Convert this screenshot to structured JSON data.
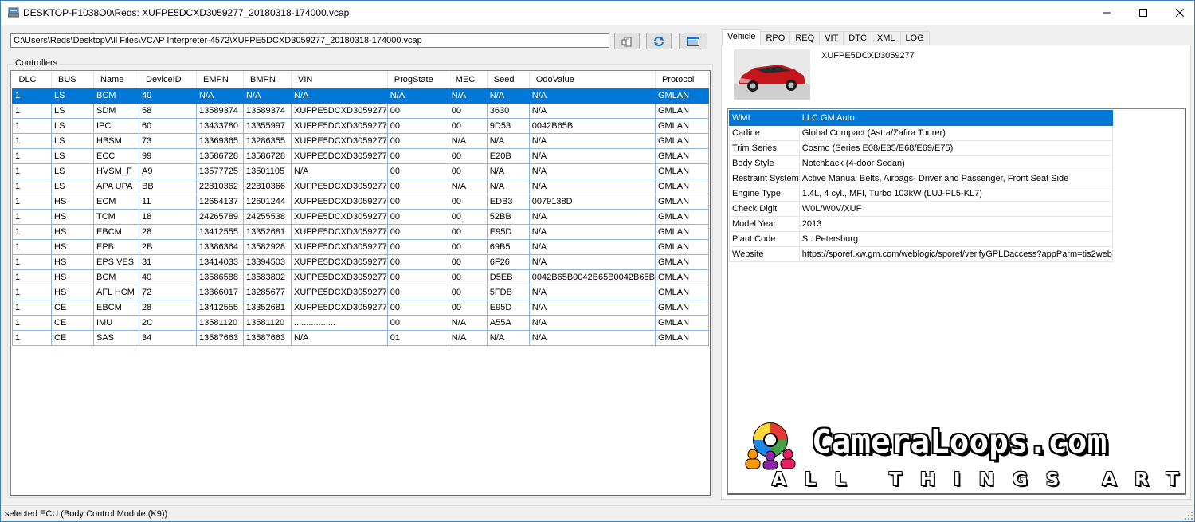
{
  "window": {
    "title": "DESKTOP-F1038O0\\Reds: XUFPE5DCXD3059277_20180318-174000.vcap"
  },
  "toolbar": {
    "path_value": "C:\\Users\\Reds\\Desktop\\All Files\\VCAP Interpreter-4572\\XUFPE5DCXD3059277_20180318-174000.vcap",
    "buttons": [
      "open-file-icon",
      "refresh-icon",
      "window-icon"
    ]
  },
  "controllers": {
    "group_label": "Controllers",
    "columns": [
      "DLC",
      "BUS",
      "Name",
      "DeviceID",
      "EMPN",
      "BMPN",
      "VIN",
      "ProgState",
      "MEC",
      "Seed",
      "OdoValue",
      "Protocol"
    ],
    "rows": [
      [
        "1",
        "LS",
        "BCM",
        "40",
        "N/A",
        "N/A",
        "N/A",
        "N/A",
        "N/A",
        "N/A",
        "N/A",
        "GMLAN"
      ],
      [
        "1",
        "LS",
        "SDM",
        "58",
        "13589374",
        "13589374",
        "XUFPE5DCXD3059277",
        "00",
        "00",
        "3630",
        "N/A",
        "GMLAN"
      ],
      [
        "1",
        "LS",
        "IPC",
        "60",
        "13433780",
        "13355997",
        "XUFPE5DCXD3059277",
        "00",
        "00",
        "9D53",
        "0042B65B",
        "GMLAN"
      ],
      [
        "1",
        "LS",
        "HBSM",
        "73",
        "13369365",
        "13286355",
        "XUFPE5DCXD3059277",
        "00",
        "N/A",
        "N/A",
        "N/A",
        "GMLAN"
      ],
      [
        "1",
        "LS",
        "ECC",
        "99",
        "13586728",
        "13586728",
        "XUFPE5DCXD3059277",
        "00",
        "00",
        "E20B",
        "N/A",
        "GMLAN"
      ],
      [
        "1",
        "LS",
        "HVSM_F",
        "A9",
        "13577725",
        "13501105",
        "N/A",
        "00",
        "00",
        "N/A",
        "N/A",
        "GMLAN"
      ],
      [
        "1",
        "LS",
        "APA UPA",
        "BB",
        "22810362",
        "22810366",
        "XUFPE5DCXD3059277",
        "00",
        "N/A",
        "N/A",
        "N/A",
        "GMLAN"
      ],
      [
        "1",
        "HS",
        "ECM",
        "11",
        "12654137",
        "12601244",
        "XUFPE5DCXD3059277",
        "00",
        "00",
        "EDB3",
        "0079138D",
        "GMLAN"
      ],
      [
        "1",
        "HS",
        "TCM",
        "18",
        "24265789",
        "24255538",
        "XUFPE5DCXD3059277",
        "00",
        "00",
        "52BB",
        "N/A",
        "GMLAN"
      ],
      [
        "1",
        "HS",
        "EBCM",
        "28",
        "13412555",
        "13352681",
        "XUFPE5DCXD3059277",
        "00",
        "00",
        "E95D",
        "N/A",
        "GMLAN"
      ],
      [
        "1",
        "HS",
        "EPB",
        "2B",
        "13386364",
        "13582928",
        "XUFPE5DCXD3059277",
        "00",
        "00",
        "69B5",
        "N/A",
        "GMLAN"
      ],
      [
        "1",
        "HS",
        "EPS VES",
        "31",
        "13414033",
        "13394503",
        "XUFPE5DCXD3059277",
        "00",
        "00",
        "6F26",
        "N/A",
        "GMLAN"
      ],
      [
        "1",
        "HS",
        "BCM",
        "40",
        "13586588",
        "13583802",
        "XUFPE5DCXD3059277",
        "00",
        "00",
        "D5EB",
        "0042B65B0042B65B0042B65B",
        "GMLAN"
      ],
      [
        "1",
        "HS",
        "AFL HCM",
        "72",
        "13366017",
        "13285677",
        "XUFPE5DCXD3059277",
        "00",
        "00",
        "5FDB",
        "N/A",
        "GMLAN"
      ],
      [
        "1",
        "CE",
        "EBCM",
        "28",
        "13412555",
        "13352681",
        "XUFPE5DCXD3059277",
        "00",
        "00",
        "E95D",
        "N/A",
        "GMLAN"
      ],
      [
        "1",
        "CE",
        "IMU",
        "2C",
        "13581120",
        "13581120",
        ".................",
        "00",
        "N/A",
        "A55A",
        "N/A",
        "GMLAN"
      ],
      [
        "1",
        "CE",
        "SAS",
        "34",
        "13587663",
        "13587663",
        "N/A",
        "01",
        "N/A",
        "N/A",
        "N/A",
        "GMLAN"
      ]
    ],
    "selected_row": 0
  },
  "right_panel": {
    "tabs": [
      "Vehicle",
      "RPO",
      "REQ",
      "VIT",
      "DTC",
      "XML",
      "LOG"
    ],
    "active_tab": 0,
    "vin": "XUFPE5DCXD3059277",
    "vehicle_info": [
      [
        "WMI",
        "LLC GM Auto"
      ],
      [
        "Carline",
        "Global Compact (Astra/Zafira Tourer)"
      ],
      [
        "Trim Series",
        "Cosmo (Series E08/E35/E68/E69/E75)"
      ],
      [
        "Body Style",
        "Notchback (4-door Sedan)"
      ],
      [
        "Restraint System",
        "Active Manual Belts, Airbags- Driver and Passenger, Front Seat Side"
      ],
      [
        "Engine Type",
        "1.4L, 4 cyl., MFI, Turbo 103kW (LUJ-PL5-KL7)"
      ],
      [
        "Check Digit",
        "W0L/W0V/XUF"
      ],
      [
        "Model Year",
        "2013"
      ],
      [
        "Plant Code",
        "St. Petersburg"
      ],
      [
        "Website",
        "https://sporef.xw.gm.com/weblogic/sporef/verifyGPLDaccess?appParm=tis2web"
      ]
    ],
    "selected_info_row": 0
  },
  "watermark": {
    "text": "CameraLoops.com",
    "subtext": "ALL THINGS ART"
  },
  "status": {
    "text": "selected ECU (Body Control Module (K9))"
  },
  "colors": {
    "selection": "#0078d7",
    "grid_line": "#8fb4dc",
    "car_red": "#c4161c"
  }
}
